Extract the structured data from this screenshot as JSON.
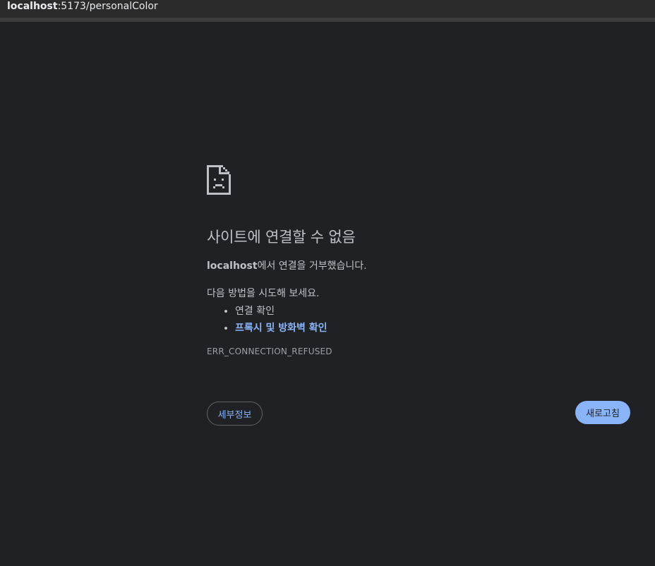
{
  "address_bar": {
    "host": "localhost",
    "path": ":5173/personalColor"
  },
  "error": {
    "heading": "사이트에 연결할 수 없음",
    "host": "localhost",
    "refused_suffix": "에서 연결을 거부했습니다.",
    "try_label": "다음 방법을 시도해 보세요.",
    "suggestions": [
      {
        "label": "연결 확인",
        "link": false
      },
      {
        "label": "프록시 및 방화벽 확인",
        "link": true
      }
    ],
    "code": "ERR_CONNECTION_REFUSED"
  },
  "buttons": {
    "details": "세부정보",
    "reload": "새로고침"
  },
  "icons": {
    "error_page": "sad-document-icon"
  },
  "colors": {
    "background": "#202124",
    "text": "#bdc1c6",
    "link": "#8ab4f8",
    "reload_button": "#8ab4f8"
  }
}
